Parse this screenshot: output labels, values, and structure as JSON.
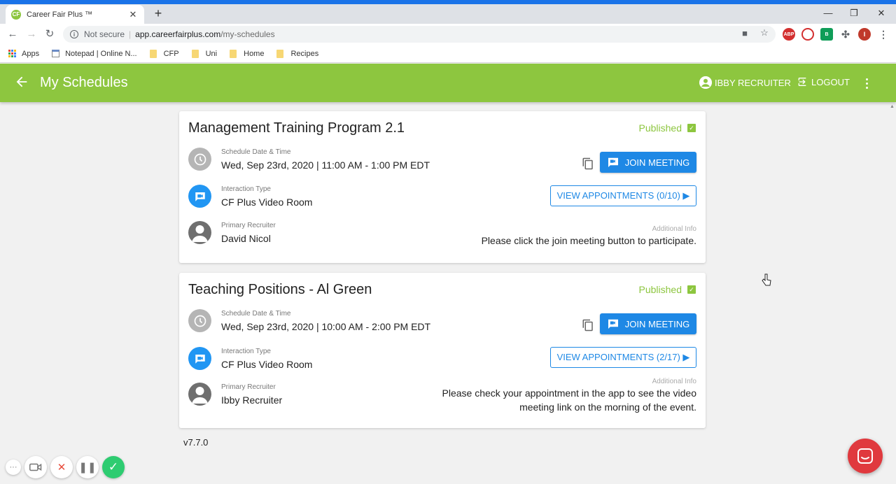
{
  "browser": {
    "tab_title": "Career Fair Plus ™",
    "new_tab": "+",
    "not_secure": "Not secure",
    "url_host": "app.careerfairplus.com",
    "url_path": "/my-schedules",
    "extensions": [
      "ABP",
      "B",
      "I"
    ],
    "bookmarks": [
      {
        "label": "Apps",
        "icon": "apps-grid-icon"
      },
      {
        "label": "Notepad | Online N...",
        "icon": "notepad-icon"
      },
      {
        "label": "CFP",
        "icon": "folder-icon"
      },
      {
        "label": "Uni",
        "icon": "folder-icon"
      },
      {
        "label": "Home",
        "icon": "folder-icon"
      },
      {
        "label": "Recipes",
        "icon": "folder-icon"
      }
    ]
  },
  "header": {
    "title": "My Schedules",
    "user_name": "IBBY RECRUITER",
    "logout": "LOGOUT",
    "color": "#8dc63f"
  },
  "schedules": [
    {
      "title": "Management Training Program 2.1",
      "status": "Published",
      "date_label": "Schedule Date & Time",
      "date_value": "Wed, Sep 23rd, 2020 | 11:00 AM - 1:00 PM EDT",
      "type_label": "Interaction Type",
      "type_value": "CF Plus Video Room",
      "recruiter_label": "Primary Recruiter",
      "recruiter_value": "David Nicol",
      "join_label": "JOIN MEETING",
      "appointments_label": "VIEW APPOINTMENTS (0/10) ▶",
      "info_label": "Additional Info",
      "info_lines": [
        "Please click the join meeting button to participate."
      ]
    },
    {
      "title": "Teaching Positions - Al Green",
      "status": "Published",
      "date_label": "Schedule Date & Time",
      "date_value": "Wed, Sep 23rd, 2020 | 10:00 AM - 2:00 PM EDT",
      "type_label": "Interaction Type",
      "type_value": "CF Plus Video Room",
      "recruiter_label": "Primary Recruiter",
      "recruiter_value": "Ibby Recruiter",
      "join_label": "JOIN MEETING",
      "appointments_label": "VIEW APPOINTMENTS (2/17) ▶",
      "info_label": "Additional Info",
      "info_lines": [
        "Please check your appointment in the app to see the video",
        "meeting link on the morning of the event."
      ]
    }
  ],
  "version": "v7.7.0",
  "colors": {
    "accent_green": "#8dc63f",
    "button_blue": "#1e88e5",
    "chat_red": "#e0393e"
  }
}
